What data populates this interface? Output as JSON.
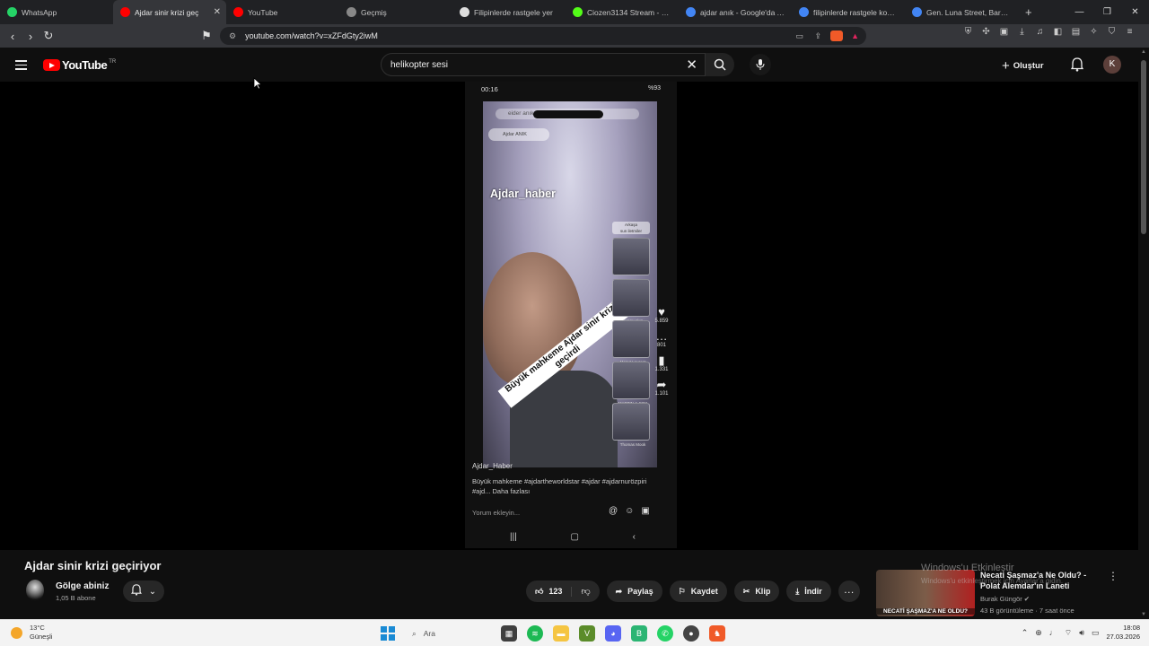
{
  "browser": {
    "tabs": [
      {
        "label": "WhatsApp",
        "color": "#25d366",
        "active": false
      },
      {
        "label": "Ajdar sinir krizi geç",
        "color": "#ff0000",
        "active": true
      },
      {
        "label": "YouTube",
        "color": "#ff0000",
        "active": false
      },
      {
        "label": "Geçmiş",
        "color": "#888888",
        "active": false
      },
      {
        "label": "Filipinlerde rastgele yer",
        "color": "#dddddd",
        "active": false
      },
      {
        "label": "Ciozen3134 Stream - Wat",
        "color": "#53fc18",
        "active": false
      },
      {
        "label": "ajdar anık - Google'da Ara",
        "color": "#4285f4",
        "active": false
      },
      {
        "label": "filipinlerde rastgele konur",
        "color": "#4285f4",
        "active": false
      },
      {
        "label": "Gen. Luna Street, Barangay",
        "color": "#4285f4",
        "active": false
      }
    ],
    "url": "youtube.com/watch?v=xZFdGty2iwM"
  },
  "youtube": {
    "logo_text": "YouTube",
    "country": "TR",
    "search_value": "helikopter sesi",
    "create_label": "Oluştur",
    "avatar_letter": "K"
  },
  "video": {
    "phone": {
      "status_time": "00:16",
      "status_right": "%93",
      "search_text": "eider anık kufur",
      "user_chip": "Ajdar ANIK",
      "overlay_handle": "Ajdar_haber",
      "banner_text": "Büyük mahkeme Ajdar sinir krizi geçirdi",
      "tiles": [
        "",
        "Sunay Akın",
        "Mesut Laurent",
        "MARTIN J. FOX",
        "Thomas Mook"
      ],
      "rail": [
        {
          "icon": "♥",
          "count": "5.859"
        },
        {
          "icon": "…",
          "count": "801"
        },
        {
          "icon": "▮",
          "count": "1.331"
        },
        {
          "icon": "➦",
          "count": "1.101"
        }
      ],
      "caption_user": "Ajdar_Haber",
      "caption_text": "Büyük mahkeme #ajdartheworldstar #ajdar #ajdarnurözpiri #ajd... Daha fazlası",
      "comment_placeholder": "Yorum ekleyin..."
    }
  },
  "details": {
    "title": "Ajdar sinir krizi geçiriyor",
    "channel": "Gölge abiniz",
    "subscribers": "1,05 B abone",
    "likes": "123",
    "share": "Paylaş",
    "save": "Kaydet",
    "clip": "Klip",
    "download": "İndir"
  },
  "recommendation": {
    "title": "Necati Şaşmaz'a Ne Oldu? - Polat Alemdar'ın Laneti",
    "channel": "Burak Güngör",
    "meta": "43 B görüntüleme · 7 saat önce",
    "thumb_text": "NECATİ ŞAŞMAZ'A NE OLDU?"
  },
  "watermark": {
    "line1": "Windows'u Etkinleştir",
    "line2": "Windows'u etkinleştirmek için Ayarlar'a gidin."
  },
  "taskbar": {
    "temp": "13°C",
    "weather": "Güneşli",
    "search": "Ara",
    "time": "18:08",
    "date": "27.03.2026"
  }
}
